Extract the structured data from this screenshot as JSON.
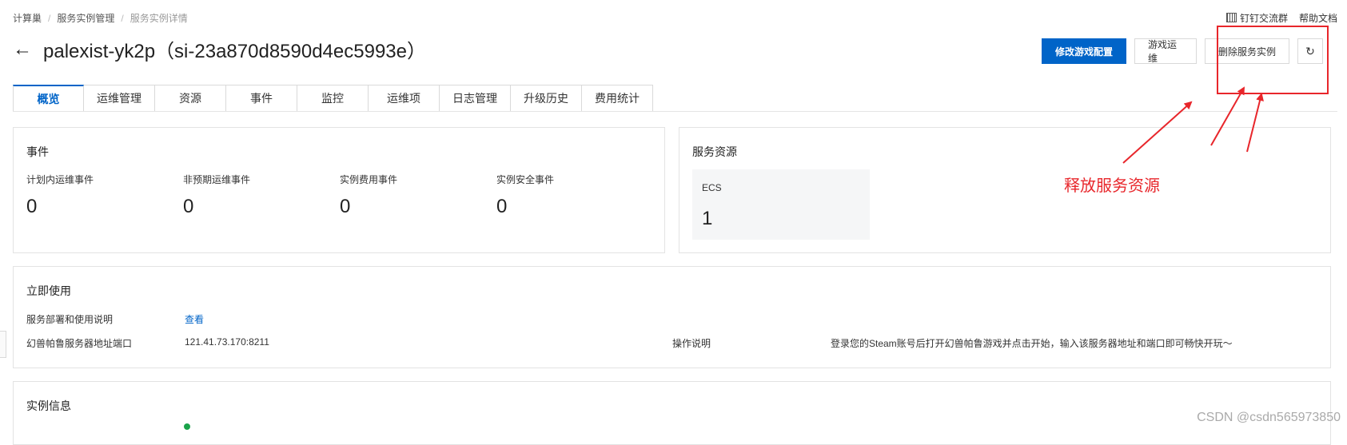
{
  "breadcrumb": [
    "计算巢",
    "服务实例管理",
    "服务实例详情"
  ],
  "top_links": {
    "dingtalk": "钉钉交流群",
    "help": "帮助文档"
  },
  "title": "palexist-yk2p（si-23a870d8590d4ec5993e）",
  "actions": {
    "modify": "修改游戏配置",
    "ops": "游戏运维",
    "delete": "删除服务实例"
  },
  "tabs": [
    "概览",
    "运维管理",
    "资源",
    "事件",
    "监控",
    "运维项",
    "日志管理",
    "升级历史",
    "费用统计"
  ],
  "events": {
    "title": "事件",
    "items": [
      {
        "label": "计划内运维事件",
        "value": "0"
      },
      {
        "label": "非预期运维事件",
        "value": "0"
      },
      {
        "label": "实例费用事件",
        "value": "0"
      },
      {
        "label": "实例安全事件",
        "value": "0"
      }
    ]
  },
  "resources": {
    "title": "服务资源",
    "items": [
      {
        "label": "ECS",
        "value": "1"
      }
    ]
  },
  "usage": {
    "title": "立即使用",
    "guide_label": "服务部署和使用说明",
    "guide_link": "查看",
    "address_label": "幻兽帕鲁服务器地址端口",
    "address_value": "121.41.73.170:8211",
    "op_label": "操作说明",
    "op_value": "登录您的Steam账号后打开幻兽帕鲁游戏并点击开始，输入该服务器地址和端口即可畅快开玩～"
  },
  "instance": {
    "title": "实例信息"
  },
  "annotation": {
    "text": "释放服务资源"
  },
  "watermark": "CSDN @csdn565973850",
  "colors": {
    "primary": "#0064c8",
    "annotation": "#e8262b",
    "status": "#1aa34a"
  }
}
